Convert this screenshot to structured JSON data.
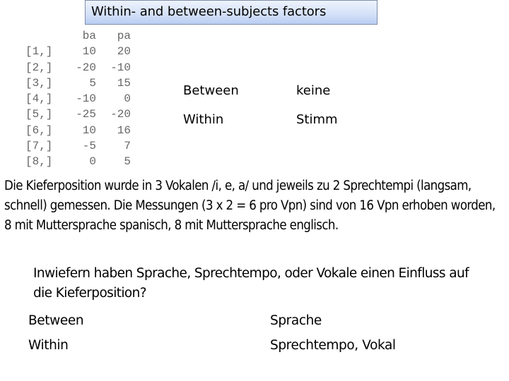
{
  "title": "Within- and between-subjects factors",
  "r_table": {
    "columns": [
      "ba",
      "pa"
    ],
    "rows": [
      {
        "index": "[1,]",
        "ba": "10",
        "pa": "20"
      },
      {
        "index": "[2,]",
        "ba": "-20",
        "pa": "-10"
      },
      {
        "index": "[3,]",
        "ba": "5",
        "pa": "15"
      },
      {
        "index": "[4,]",
        "ba": "-10",
        "pa": "0"
      },
      {
        "index": "[5,]",
        "ba": "-25",
        "pa": "-20"
      },
      {
        "index": "[6,]",
        "ba": "10",
        "pa": "16"
      },
      {
        "index": "[7,]",
        "ba": "-5",
        "pa": "7"
      },
      {
        "index": "[8,]",
        "ba": "0",
        "pa": "5"
      }
    ]
  },
  "example_factors": [
    {
      "label": "Between",
      "value": "keine"
    },
    {
      "label": "Within",
      "value": "Stimm"
    }
  ],
  "paragraph": "Die Kieferposition wurde in 3 Vokalen /i, e, a/ und jeweils zu 2 Sprechtempi (langsam, schnell) gemessen. Die Messungen (3 x 2 = 6 pro Vpn) sind von 16 Vpn erhoben worden, 8 mit Muttersprache spanisch, 8 mit Muttersprache englisch.",
  "question": "Inwiefern haben Sprache, Sprechtempo, oder Vokale einen Einfluss auf die Kieferposition?",
  "answer_factors": [
    {
      "label": "Between",
      "value": "Sprache"
    },
    {
      "label": "Within",
      "value": "Sprechtempo, Vokal"
    }
  ]
}
